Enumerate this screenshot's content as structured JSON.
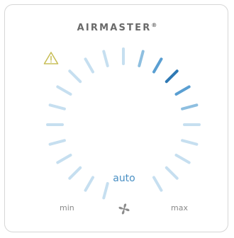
{
  "brand": {
    "name": "AIRMASTER",
    "mark": "®"
  },
  "status": {
    "warning_icon": "warning-triangle-icon",
    "warning_color": "#c9bf5a"
  },
  "dial": {
    "mode_label": "auto",
    "min_label": "min",
    "max_label": "max",
    "fan_icon": "fan-icon",
    "selected_step": 3,
    "step_count": 22,
    "colors": {
      "inactive": "#c6dff0",
      "near": "#8ebfe0",
      "mid": "#5a9fd2",
      "active": "#2f79b4"
    }
  }
}
